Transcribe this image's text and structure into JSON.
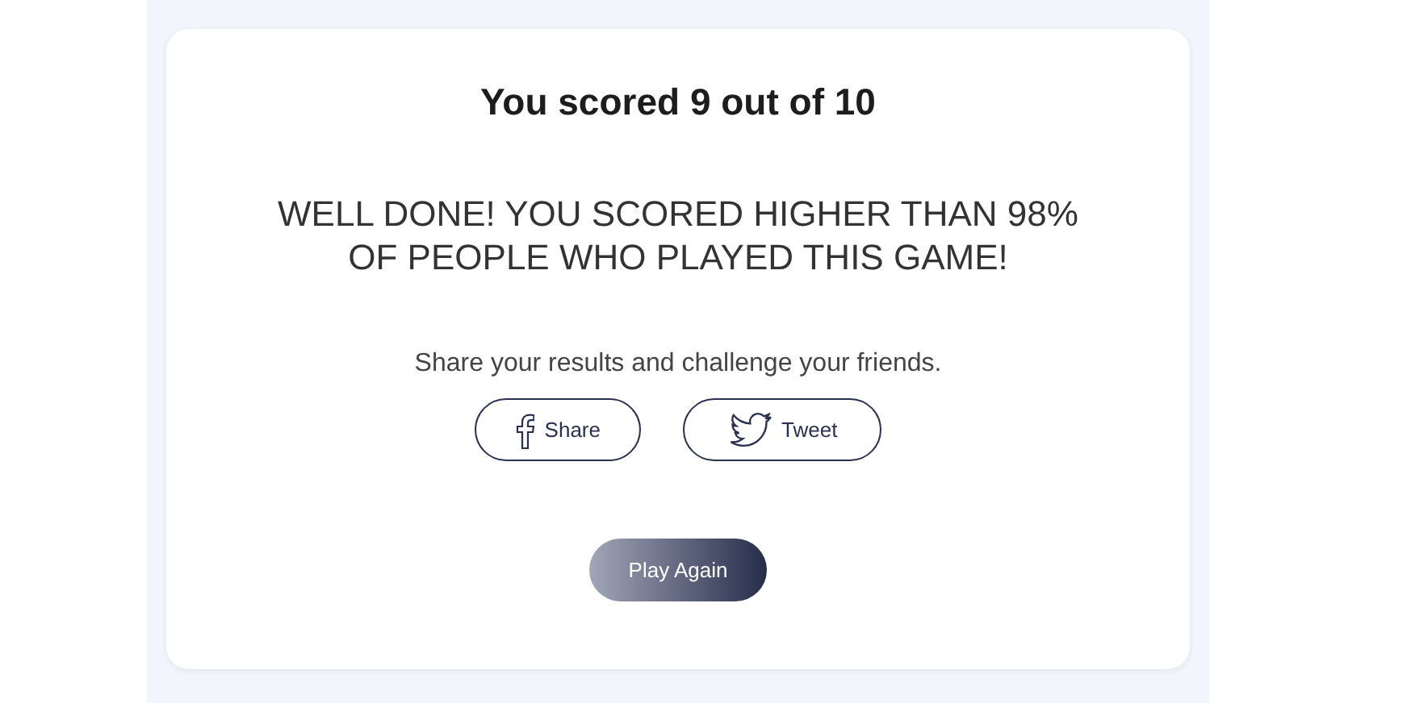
{
  "result": {
    "title": "You scored 9 out of 10",
    "message": "WELL DONE! YOU SCORED HIGHER THAN 98% OF PEOPLE WHO PLAYED THIS GAME!",
    "share_prompt": "Share your results and challenge your friends.",
    "share_buttons": [
      {
        "kind": "facebook",
        "label": "Share"
      },
      {
        "kind": "twitter",
        "label": "Tweet"
      }
    ],
    "play_again": "Play Again"
  }
}
